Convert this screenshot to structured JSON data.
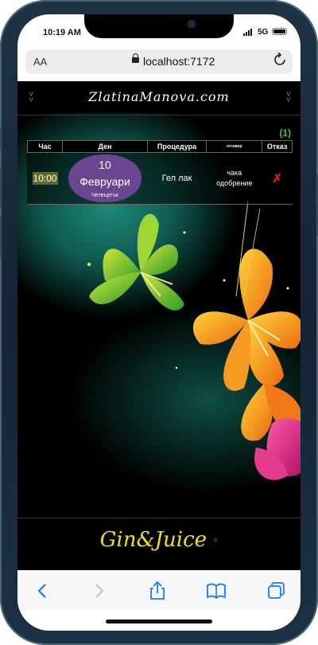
{
  "status_bar": {
    "time": "10:19 AM",
    "network": "5G"
  },
  "browser": {
    "text_size_label": "AA",
    "url": "localhost:7172"
  },
  "site": {
    "logo": "ZlatinaManova.com",
    "appointments_count": "(1)",
    "table": {
      "headers": {
        "hour": "Час",
        "day": "Ден",
        "procedure": "Процедура",
        "status": "отговор",
        "cancel": "Отказ"
      },
      "rows": [
        {
          "hour": "10:00",
          "day_number": "10",
          "month": "Февруари",
          "weekday": "Четвъртък",
          "procedure": "Гел лак",
          "status_line1": "чака",
          "status_line2": "одобрение",
          "cancel": "✗"
        }
      ]
    },
    "footer_logo": "Gin&Juice",
    "footer_mark": "®"
  },
  "colors": {
    "accent_green": "#3ec03e",
    "day_bubble": "#6a4590",
    "cancel_red": "#e01818",
    "footer_yellow": "#f0e020"
  },
  "icons": [
    "back-icon",
    "forward-icon",
    "share-icon",
    "bookmarks-icon",
    "tabs-icon",
    "reload-icon",
    "lock-icon"
  ]
}
